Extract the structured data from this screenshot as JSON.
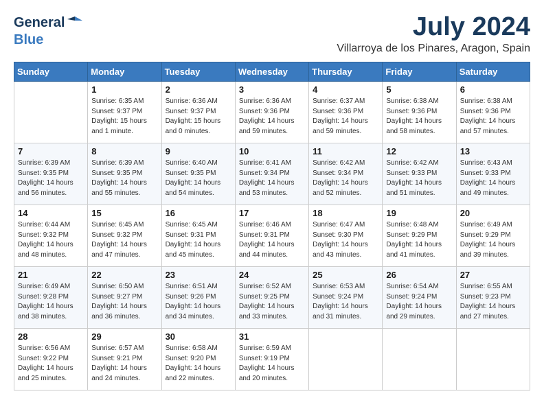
{
  "header": {
    "logo_general": "General",
    "logo_blue": "Blue",
    "month_year": "July 2024",
    "location": "Villarroya de los Pinares, Aragon, Spain"
  },
  "columns": [
    "Sunday",
    "Monday",
    "Tuesday",
    "Wednesday",
    "Thursday",
    "Friday",
    "Saturday"
  ],
  "weeks": [
    [
      {
        "day": "",
        "info": ""
      },
      {
        "day": "1",
        "info": "Sunrise: 6:35 AM\nSunset: 9:37 PM\nDaylight: 15 hours\nand 1 minute."
      },
      {
        "day": "2",
        "info": "Sunrise: 6:36 AM\nSunset: 9:37 PM\nDaylight: 15 hours\nand 0 minutes."
      },
      {
        "day": "3",
        "info": "Sunrise: 6:36 AM\nSunset: 9:36 PM\nDaylight: 14 hours\nand 59 minutes."
      },
      {
        "day": "4",
        "info": "Sunrise: 6:37 AM\nSunset: 9:36 PM\nDaylight: 14 hours\nand 59 minutes."
      },
      {
        "day": "5",
        "info": "Sunrise: 6:38 AM\nSunset: 9:36 PM\nDaylight: 14 hours\nand 58 minutes."
      },
      {
        "day": "6",
        "info": "Sunrise: 6:38 AM\nSunset: 9:36 PM\nDaylight: 14 hours\nand 57 minutes."
      }
    ],
    [
      {
        "day": "7",
        "info": "Sunrise: 6:39 AM\nSunset: 9:35 PM\nDaylight: 14 hours\nand 56 minutes."
      },
      {
        "day": "8",
        "info": "Sunrise: 6:39 AM\nSunset: 9:35 PM\nDaylight: 14 hours\nand 55 minutes."
      },
      {
        "day": "9",
        "info": "Sunrise: 6:40 AM\nSunset: 9:35 PM\nDaylight: 14 hours\nand 54 minutes."
      },
      {
        "day": "10",
        "info": "Sunrise: 6:41 AM\nSunset: 9:34 PM\nDaylight: 14 hours\nand 53 minutes."
      },
      {
        "day": "11",
        "info": "Sunrise: 6:42 AM\nSunset: 9:34 PM\nDaylight: 14 hours\nand 52 minutes."
      },
      {
        "day": "12",
        "info": "Sunrise: 6:42 AM\nSunset: 9:33 PM\nDaylight: 14 hours\nand 51 minutes."
      },
      {
        "day": "13",
        "info": "Sunrise: 6:43 AM\nSunset: 9:33 PM\nDaylight: 14 hours\nand 49 minutes."
      }
    ],
    [
      {
        "day": "14",
        "info": "Sunrise: 6:44 AM\nSunset: 9:32 PM\nDaylight: 14 hours\nand 48 minutes."
      },
      {
        "day": "15",
        "info": "Sunrise: 6:45 AM\nSunset: 9:32 PM\nDaylight: 14 hours\nand 47 minutes."
      },
      {
        "day": "16",
        "info": "Sunrise: 6:45 AM\nSunset: 9:31 PM\nDaylight: 14 hours\nand 45 minutes."
      },
      {
        "day": "17",
        "info": "Sunrise: 6:46 AM\nSunset: 9:31 PM\nDaylight: 14 hours\nand 44 minutes."
      },
      {
        "day": "18",
        "info": "Sunrise: 6:47 AM\nSunset: 9:30 PM\nDaylight: 14 hours\nand 43 minutes."
      },
      {
        "day": "19",
        "info": "Sunrise: 6:48 AM\nSunset: 9:29 PM\nDaylight: 14 hours\nand 41 minutes."
      },
      {
        "day": "20",
        "info": "Sunrise: 6:49 AM\nSunset: 9:29 PM\nDaylight: 14 hours\nand 39 minutes."
      }
    ],
    [
      {
        "day": "21",
        "info": "Sunrise: 6:49 AM\nSunset: 9:28 PM\nDaylight: 14 hours\nand 38 minutes."
      },
      {
        "day": "22",
        "info": "Sunrise: 6:50 AM\nSunset: 9:27 PM\nDaylight: 14 hours\nand 36 minutes."
      },
      {
        "day": "23",
        "info": "Sunrise: 6:51 AM\nSunset: 9:26 PM\nDaylight: 14 hours\nand 34 minutes."
      },
      {
        "day": "24",
        "info": "Sunrise: 6:52 AM\nSunset: 9:25 PM\nDaylight: 14 hours\nand 33 minutes."
      },
      {
        "day": "25",
        "info": "Sunrise: 6:53 AM\nSunset: 9:24 PM\nDaylight: 14 hours\nand 31 minutes."
      },
      {
        "day": "26",
        "info": "Sunrise: 6:54 AM\nSunset: 9:24 PM\nDaylight: 14 hours\nand 29 minutes."
      },
      {
        "day": "27",
        "info": "Sunrise: 6:55 AM\nSunset: 9:23 PM\nDaylight: 14 hours\nand 27 minutes."
      }
    ],
    [
      {
        "day": "28",
        "info": "Sunrise: 6:56 AM\nSunset: 9:22 PM\nDaylight: 14 hours\nand 25 minutes."
      },
      {
        "day": "29",
        "info": "Sunrise: 6:57 AM\nSunset: 9:21 PM\nDaylight: 14 hours\nand 24 minutes."
      },
      {
        "day": "30",
        "info": "Sunrise: 6:58 AM\nSunset: 9:20 PM\nDaylight: 14 hours\nand 22 minutes."
      },
      {
        "day": "31",
        "info": "Sunrise: 6:59 AM\nSunset: 9:19 PM\nDaylight: 14 hours\nand 20 minutes."
      },
      {
        "day": "",
        "info": ""
      },
      {
        "day": "",
        "info": ""
      },
      {
        "day": "",
        "info": ""
      }
    ]
  ]
}
